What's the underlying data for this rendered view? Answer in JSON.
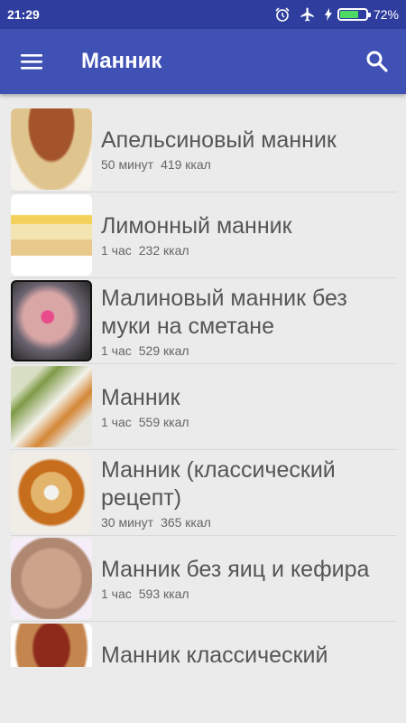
{
  "status_bar": {
    "time": "21:29",
    "battery": "72%",
    "battery_level": 0.72
  },
  "app_bar": {
    "title": "Манник"
  },
  "recipes": [
    {
      "name": "Апельсиновый манник",
      "time": "50 минут",
      "kcal": "419 ккал"
    },
    {
      "name": "Лимонный манник",
      "time": "1 час",
      "kcal": "232 ккал"
    },
    {
      "name": "Малиновый манник без муки на сметане",
      "time": "1 час",
      "kcal": "529 ккал"
    },
    {
      "name": "Манник",
      "time": "1 час",
      "kcal": "559 ккал"
    },
    {
      "name": "Манник (классический рецепт)",
      "time": "30 минут",
      "kcal": "365 ккал"
    },
    {
      "name": "Манник без яиц и кефира",
      "time": "1 час",
      "kcal": "593 ккал"
    },
    {
      "name": "Манник классический",
      "time": "",
      "kcal": ""
    }
  ]
}
